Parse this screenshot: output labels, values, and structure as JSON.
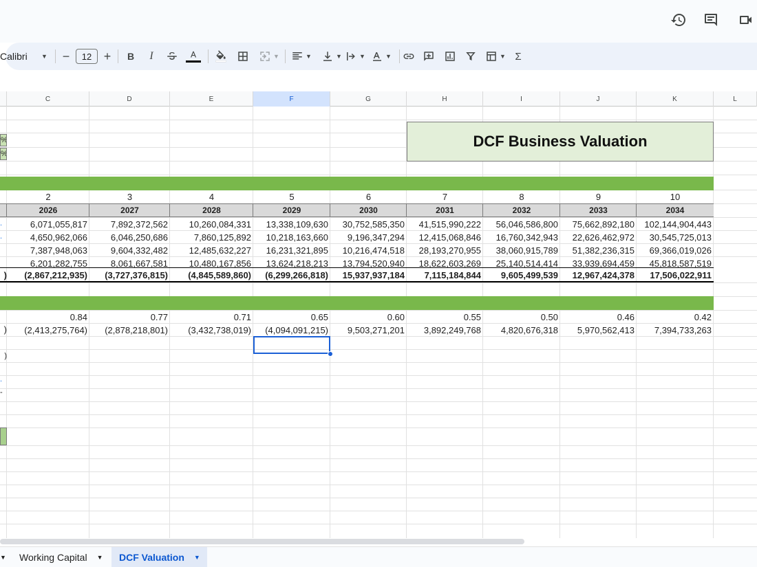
{
  "toolbar": {
    "font": "Calibri",
    "font_size": "12",
    "bold": "B",
    "italic": "I",
    "sum": "Σ"
  },
  "columns": [
    "C",
    "D",
    "E",
    "F",
    "G",
    "H",
    "I",
    "J",
    "K",
    "L"
  ],
  "title": "DCF Business Valuation",
  "periods": [
    "2",
    "3",
    "4",
    "5",
    "6",
    "7",
    "8",
    "9",
    "10"
  ],
  "years": [
    "2026",
    "2027",
    "2028",
    "2029",
    "2030",
    "2031",
    "2032",
    "2033",
    "2034"
  ],
  "rows": [
    [
      "6,071,055,817",
      "7,892,372,562",
      "10,260,084,331",
      "13,338,109,630",
      "30,752,585,350",
      "41,515,990,222",
      "56,046,586,800",
      "75,662,892,180",
      "102,144,904,443"
    ],
    [
      "4,650,962,066",
      "6,046,250,686",
      "7,860,125,892",
      "10,218,163,660",
      "9,196,347,294",
      "12,415,068,846",
      "16,760,342,943",
      "22,626,462,972",
      "30,545,725,013"
    ],
    [
      "7,387,948,063",
      "9,604,332,482",
      "12,485,632,227",
      "16,231,321,895",
      "10,216,474,518",
      "28,193,270,955",
      "38,060,915,789",
      "51,382,236,315",
      "69,366,019,026"
    ],
    [
      "6,201,282,755",
      "8,061,667,581",
      "10,480,167,856",
      "13,624,218,213",
      "13,794,520,940",
      "18,622,603,269",
      "25,140,514,414",
      "33,939,694,459",
      "45,818,587,519"
    ]
  ],
  "total_row": [
    "(2,867,212,935)",
    "(3,727,376,815)",
    "(4,845,589,860)",
    "(6,299,266,818)",
    "15,937,937,184",
    "7,115,184,844",
    "9,605,499,539",
    "12,967,424,378",
    "17,506,022,911"
  ],
  "discount_factors": [
    "0.84",
    "0.77",
    "0.71",
    "0.65",
    "0.60",
    "0.55",
    "0.50",
    "0.46",
    "0.42"
  ],
  "pv_row": [
    "(2,413,275,764)",
    "(2,878,218,801)",
    "(3,432,738,019)",
    "(4,094,091,215)",
    "9,503,271,201",
    "3,892,249,768",
    "4,820,676,318",
    "5,970,562,413",
    "7,394,733,263"
  ],
  "left_fragments": {
    "pct1": "%",
    "pct2": "%",
    "total_paren": ")",
    "pv_paren": ")",
    "row_paren": ")"
  },
  "tabs": {
    "working_capital": "Working Capital",
    "dcf_valuation": "DCF Valuation"
  }
}
